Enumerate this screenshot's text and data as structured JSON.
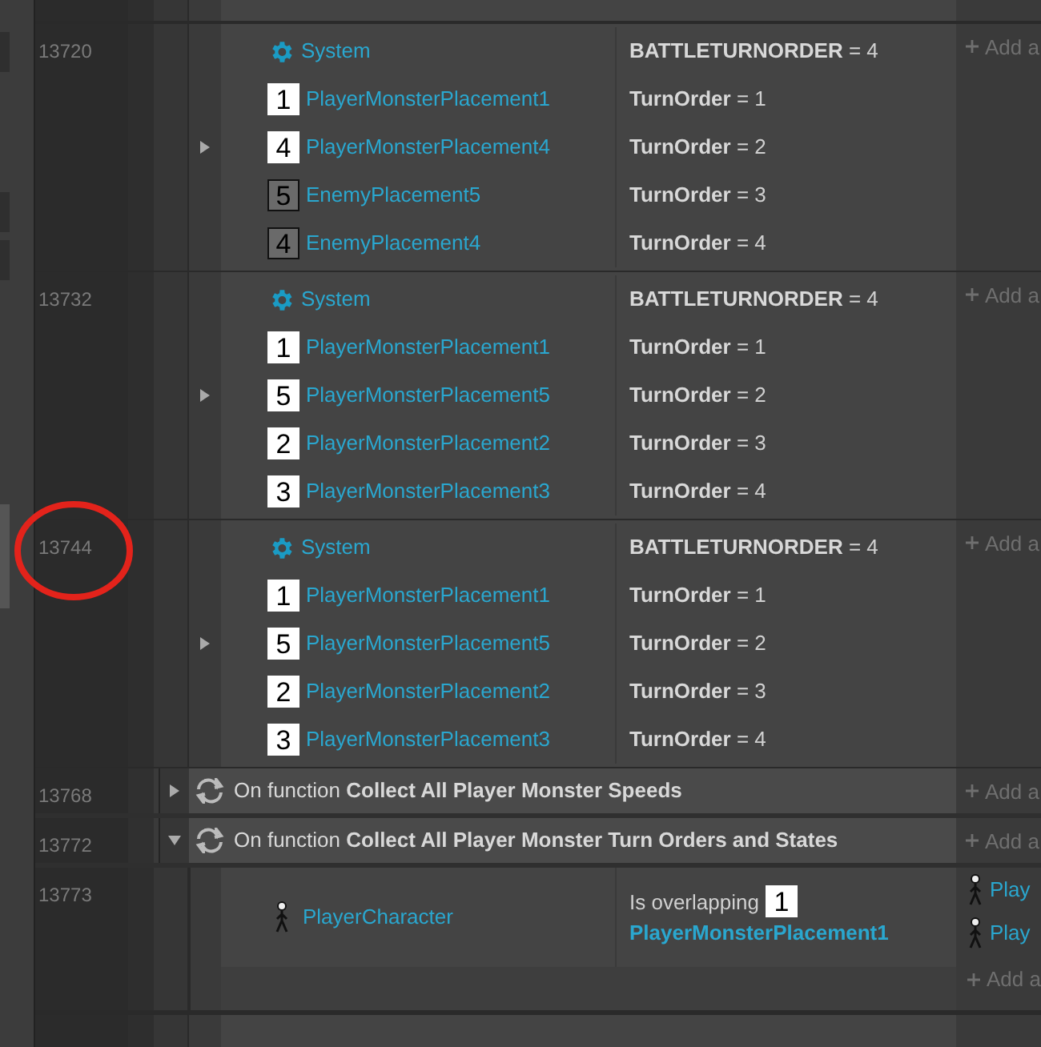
{
  "blocks": [
    {
      "line": "13720",
      "expanded": false,
      "rows": [
        {
          "kind": "system",
          "object": "System",
          "condition": "**BATTLETURNORDER** = 4"
        },
        {
          "kind": "player",
          "badge": "1",
          "object": "PlayerMonsterPlacement1",
          "condition": "**TurnOrder** = 1"
        },
        {
          "kind": "player",
          "badge": "4",
          "object": "PlayerMonsterPlacement4",
          "condition": "**TurnOrder** = 2"
        },
        {
          "kind": "enemy",
          "badge": "5",
          "object": "EnemyPlacement5",
          "condition": "**TurnOrder** = 3"
        },
        {
          "kind": "enemy",
          "badge": "4",
          "object": "EnemyPlacement4",
          "condition": "**TurnOrder** = 4"
        }
      ],
      "add": "Add a"
    },
    {
      "line": "13732",
      "expanded": false,
      "rows": [
        {
          "kind": "system",
          "object": "System",
          "condition": "**BATTLETURNORDER** = 4"
        },
        {
          "kind": "player",
          "badge": "1",
          "object": "PlayerMonsterPlacement1",
          "condition": "**TurnOrder** = 1"
        },
        {
          "kind": "player",
          "badge": "5",
          "object": "PlayerMonsterPlacement5",
          "condition": "**TurnOrder** = 2"
        },
        {
          "kind": "player",
          "badge": "2",
          "object": "PlayerMonsterPlacement2",
          "condition": "**TurnOrder** = 3"
        },
        {
          "kind": "player",
          "badge": "3",
          "object": "PlayerMonsterPlacement3",
          "condition": "**TurnOrder** = 4"
        }
      ],
      "add": "Add a"
    },
    {
      "line": "13744",
      "expanded": false,
      "rows": [
        {
          "kind": "system",
          "object": "System",
          "condition": "**BATTLETURNORDER** = 4"
        },
        {
          "kind": "player",
          "badge": "1",
          "object": "PlayerMonsterPlacement1",
          "condition": "**TurnOrder** = 1"
        },
        {
          "kind": "player",
          "badge": "5",
          "object": "PlayerMonsterPlacement5",
          "condition": "**TurnOrder** = 2"
        },
        {
          "kind": "player",
          "badge": "2",
          "object": "PlayerMonsterPlacement2",
          "condition": "**TurnOrder** = 3"
        },
        {
          "kind": "player",
          "badge": "3",
          "object": "PlayerMonsterPlacement3",
          "condition": "**TurnOrder** = 4"
        }
      ],
      "add": "Add a"
    }
  ],
  "functions": [
    {
      "line": "13768",
      "expanded": false,
      "prefix": "On function",
      "name": "Collect All Player Monster Speeds",
      "add": "Add a"
    },
    {
      "line": "13772",
      "expanded": true,
      "prefix": "On function",
      "name": "Collect All Player Monster Turn Orders and States",
      "add": "Add a"
    }
  ],
  "sub_event": {
    "line": "13773",
    "object": "PlayerCharacter",
    "condition": "Is overlapping",
    "badge": "1",
    "target": "PlayerMonsterPlacement1",
    "actions": [
      {
        "object": "Play"
      },
      {
        "object": "Play"
      }
    ],
    "add": "Add a"
  },
  "annotation": {
    "kind": "circle"
  }
}
